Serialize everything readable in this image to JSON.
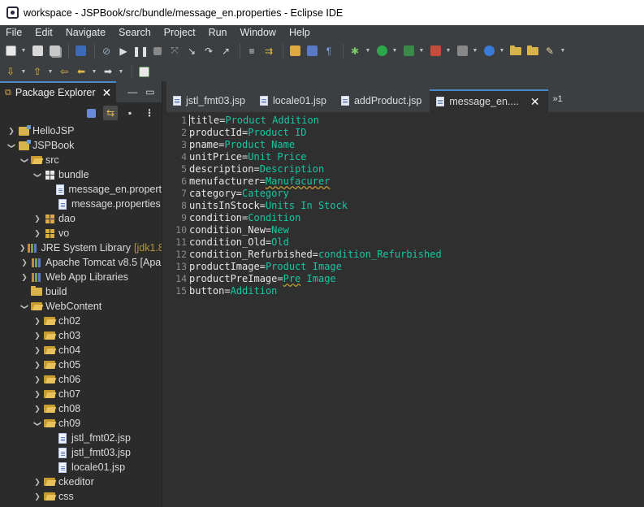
{
  "window": {
    "title": "workspace - JSPBook/src/bundle/message_en.properties - Eclipse IDE"
  },
  "menu": [
    "File",
    "Edit",
    "Navigate",
    "Search",
    "Project",
    "Run",
    "Window",
    "Help"
  ],
  "toolbar1_icons": [
    "new-icon",
    "save-icon",
    "save-all-icon",
    "console-icon",
    "skip-breakpoints-icon",
    "resume-icon",
    "suspend-icon",
    "terminate-icon",
    "disconnect-icon",
    "step-into-icon",
    "step-over-icon",
    "step-return-icon",
    "drop-to-frame-icon",
    "toggle-block-icon",
    "next-annotation-icon",
    "open-type-icon",
    "open-task-icon",
    "show-whitespace-icon",
    "debug-icon",
    "run-icon",
    "coverage-icon",
    "external-tools-icon",
    "server-icon",
    "open-folder-icon",
    "edit-icon"
  ],
  "toolbar2_icons": [
    "pin-icon",
    "last-edit-icon",
    "back-icon",
    "forward-icon",
    "new-window-icon"
  ],
  "explorer": {
    "tab_label": "Package Explorer",
    "tree": [
      {
        "indent": 0,
        "chevron": "right",
        "icon": "project",
        "label": "HelloJSP"
      },
      {
        "indent": 0,
        "chevron": "down",
        "icon": "project",
        "label": "JSPBook"
      },
      {
        "indent": 1,
        "chevron": "down",
        "icon": "package-folder",
        "label": "src"
      },
      {
        "indent": 2,
        "chevron": "down",
        "icon": "package-white",
        "label": "bundle"
      },
      {
        "indent": 3,
        "chevron": "",
        "icon": "file",
        "label": "message_en.propert"
      },
      {
        "indent": 3,
        "chevron": "",
        "icon": "file",
        "label": "message.properties"
      },
      {
        "indent": 2,
        "chevron": "right",
        "icon": "package",
        "label": "dao"
      },
      {
        "indent": 2,
        "chevron": "right",
        "icon": "package",
        "label": "vo"
      },
      {
        "indent": 1,
        "chevron": "right",
        "icon": "library",
        "label": "JRE System Library",
        "decoration": "[jdk1.8"
      },
      {
        "indent": 1,
        "chevron": "right",
        "icon": "library",
        "label": "Apache Tomcat v8.5 [Apa"
      },
      {
        "indent": 1,
        "chevron": "right",
        "icon": "library",
        "label": "Web App Libraries"
      },
      {
        "indent": 1,
        "chevron": "",
        "icon": "folder",
        "label": "build"
      },
      {
        "indent": 1,
        "chevron": "down",
        "icon": "open-folder",
        "label": "WebContent"
      },
      {
        "indent": 2,
        "chevron": "right",
        "icon": "open-folder",
        "label": "ch02"
      },
      {
        "indent": 2,
        "chevron": "right",
        "icon": "open-folder",
        "label": "ch03"
      },
      {
        "indent": 2,
        "chevron": "right",
        "icon": "open-folder",
        "label": "ch04"
      },
      {
        "indent": 2,
        "chevron": "right",
        "icon": "open-folder",
        "label": "ch05"
      },
      {
        "indent": 2,
        "chevron": "right",
        "icon": "open-folder",
        "label": "ch06"
      },
      {
        "indent": 2,
        "chevron": "right",
        "icon": "open-folder",
        "label": "ch07"
      },
      {
        "indent": 2,
        "chevron": "right",
        "icon": "open-folder",
        "label": "ch08"
      },
      {
        "indent": 2,
        "chevron": "down",
        "icon": "open-folder",
        "label": "ch09"
      },
      {
        "indent": 3,
        "chevron": "",
        "icon": "file",
        "label": "jstl_fmt02.jsp"
      },
      {
        "indent": 3,
        "chevron": "",
        "icon": "file",
        "label": "jstl_fmt03.jsp"
      },
      {
        "indent": 3,
        "chevron": "",
        "icon": "file",
        "label": "locale01.jsp"
      },
      {
        "indent": 2,
        "chevron": "right",
        "icon": "open-folder",
        "label": "ckeditor"
      },
      {
        "indent": 2,
        "chevron": "right",
        "icon": "open-folder",
        "label": "css"
      }
    ]
  },
  "editor": {
    "tabs": [
      {
        "label": "jstl_fmt03.jsp",
        "active": false
      },
      {
        "label": "locale01.jsp",
        "active": false
      },
      {
        "label": "addProduct.jsp",
        "active": false
      },
      {
        "label": "message_en....",
        "active": true
      }
    ],
    "overflow_label": "»1",
    "lines": [
      {
        "num": "1",
        "key": "title",
        "value": "Product Addition",
        "squiggle": false
      },
      {
        "num": "2",
        "key": "productId",
        "value": "Product ID",
        "squiggle": false
      },
      {
        "num": "3",
        "key": "pname",
        "value": "Product Name",
        "squiggle": false
      },
      {
        "num": "4",
        "key": "unitPrice",
        "value": "Unit Price",
        "squiggle": false
      },
      {
        "num": "5",
        "key": "description",
        "value": "Description",
        "squiggle": false
      },
      {
        "num": "6",
        "key": "menufacturer",
        "value": "Manufacurer",
        "squiggle": true
      },
      {
        "num": "7",
        "key": "category",
        "value": "Category",
        "squiggle": false
      },
      {
        "num": "8",
        "key": "unitsInStock",
        "value": "Units In Stock",
        "squiggle": false
      },
      {
        "num": "9",
        "key": "condition",
        "value": "Condition",
        "squiggle": false
      },
      {
        "num": "10",
        "key": "condition_New",
        "value": "New",
        "squiggle": false
      },
      {
        "num": "11",
        "key": "condition_Old",
        "value": "Old",
        "squiggle": false
      },
      {
        "num": "12",
        "key": "condition_Refurbished",
        "value": "condition_Refurbished",
        "squiggle": false
      },
      {
        "num": "13",
        "key": "productImage",
        "value": "Product Image",
        "squiggle": false
      },
      {
        "num": "14",
        "key": "productPreImage",
        "value": "Pre Image",
        "squiggle": "Pre"
      },
      {
        "num": "15",
        "key": "button",
        "value": "Addition",
        "squiggle": false
      }
    ]
  },
  "colors": {
    "value_text": "#17c6a3",
    "key_text": "#e6e6e6",
    "active_tab_accent": "#4a88c7"
  }
}
